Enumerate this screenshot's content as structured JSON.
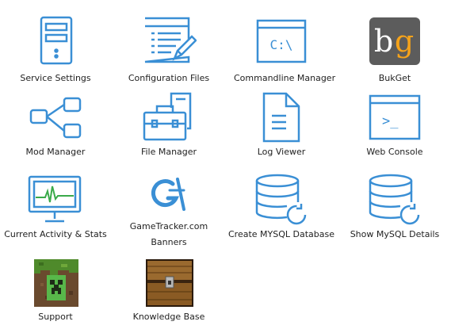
{
  "tiles": [
    {
      "label": "Service Settings",
      "icon": "server-tower-icon"
    },
    {
      "label": "Configuration Files",
      "icon": "config-file-pencil-icon"
    },
    {
      "label": "Commandline Manager",
      "icon": "command-window-icon",
      "icon_text": "C:\\"
    },
    {
      "label": "BukGet",
      "icon": "bukget-logo-icon",
      "icon_text_b": "b",
      "icon_text_g": "g"
    },
    {
      "label": "Mod Manager",
      "icon": "tree-nodes-icon"
    },
    {
      "label": "File Manager",
      "icon": "toolbox-file-icon"
    },
    {
      "label": "Log Viewer",
      "icon": "document-lines-icon"
    },
    {
      "label": "Web Console",
      "icon": "terminal-prompt-icon",
      "icon_text": ">_"
    },
    {
      "label": "Current Activity & Stats",
      "icon": "monitor-pulse-icon"
    },
    {
      "label_line1": "GameTracker.com",
      "label_line2": "Banners",
      "icon": "gametracker-logo-icon"
    },
    {
      "label": "Create MYSQL Database",
      "icon": "database-refresh-icon"
    },
    {
      "label": "Show MySQL Details",
      "icon": "database-refresh-icon"
    },
    {
      "label": "Support",
      "icon": "creeper-block-icon"
    },
    {
      "label": "Knowledge Base",
      "icon": "treasure-chest-icon"
    }
  ],
  "colors": {
    "icon_blue": "#3a8fd5",
    "label_text": "#222222",
    "bukget_bg": "#5c5c5c",
    "bukget_g": "#f6a31a"
  }
}
